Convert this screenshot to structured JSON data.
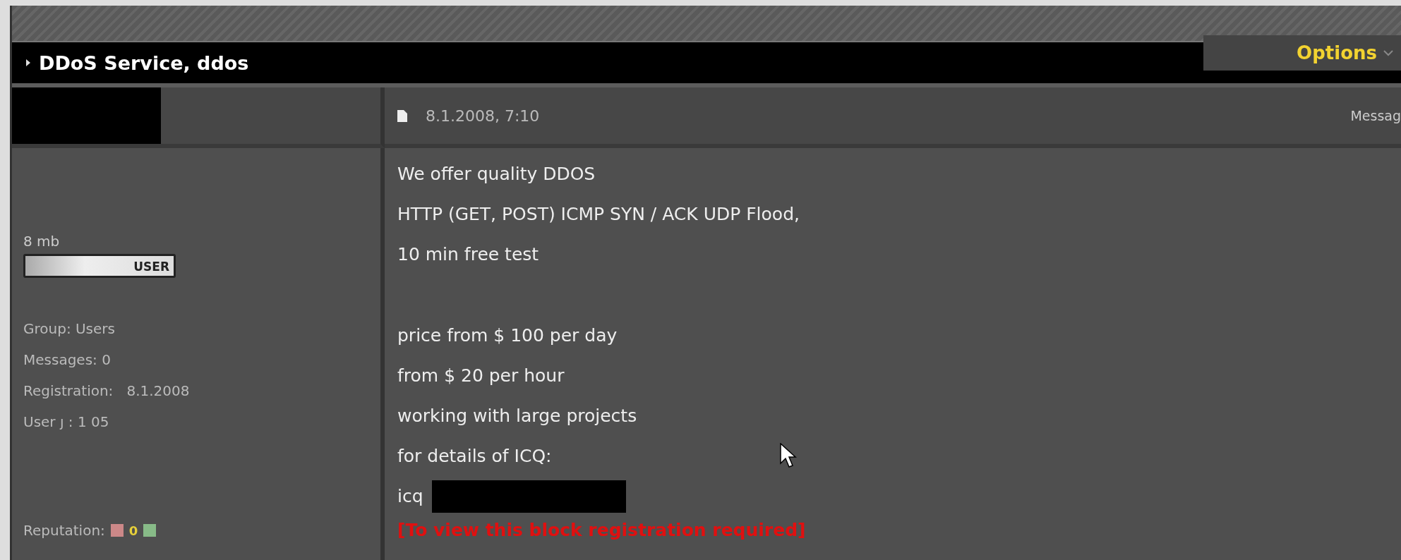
{
  "thread": {
    "title": "DDoS Service, ddos",
    "options_button": "Options"
  },
  "post": {
    "date": "8.1.2008, 7:10",
    "header_right": "Messag",
    "author": {
      "size": "8 mb",
      "rank": "USER",
      "stats": [
        "Group: Users",
        "Messages: 0",
        "Registration:   8.1.2008",
        "User ȷ : 1 05"
      ],
      "reputation_label": "Reputation:",
      "reputation_value": "0"
    },
    "paragraphs": [
      [
        "We offer quality DDOS",
        "HTTP (GET, POST) ICMP SYN / ACK UDP Flood,",
        "10 min free test"
      ],
      [
        "price from $ 100 per day",
        "from $ 20 per hour",
        "working with large projects",
        "for details of ICQ:"
      ]
    ],
    "icq_label": "icq",
    "hidden_notice": "[To view this block registration required]"
  }
}
